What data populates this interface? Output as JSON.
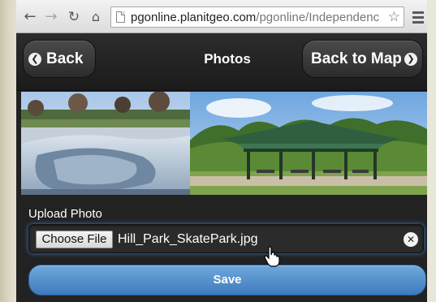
{
  "browser": {
    "url_host": "pgonline.planitgeo.com",
    "url_path": "/pgonline/Independenc"
  },
  "header": {
    "back_label": "Back",
    "title": "Photos",
    "map_label": "Back to Map"
  },
  "photos": [
    {
      "subject": "skate park bowl"
    },
    {
      "subject": "park picnic pavilion"
    }
  ],
  "upload": {
    "label": "Upload Photo",
    "choose_label": "Choose File",
    "file_name": "Hill_Park_SkatePark.jpg"
  },
  "save_label": "Save",
  "colors": {
    "save_button": "#4f8ccb",
    "focus_glow": "#3b7dc0",
    "header_bg": "#1e1e1e"
  }
}
